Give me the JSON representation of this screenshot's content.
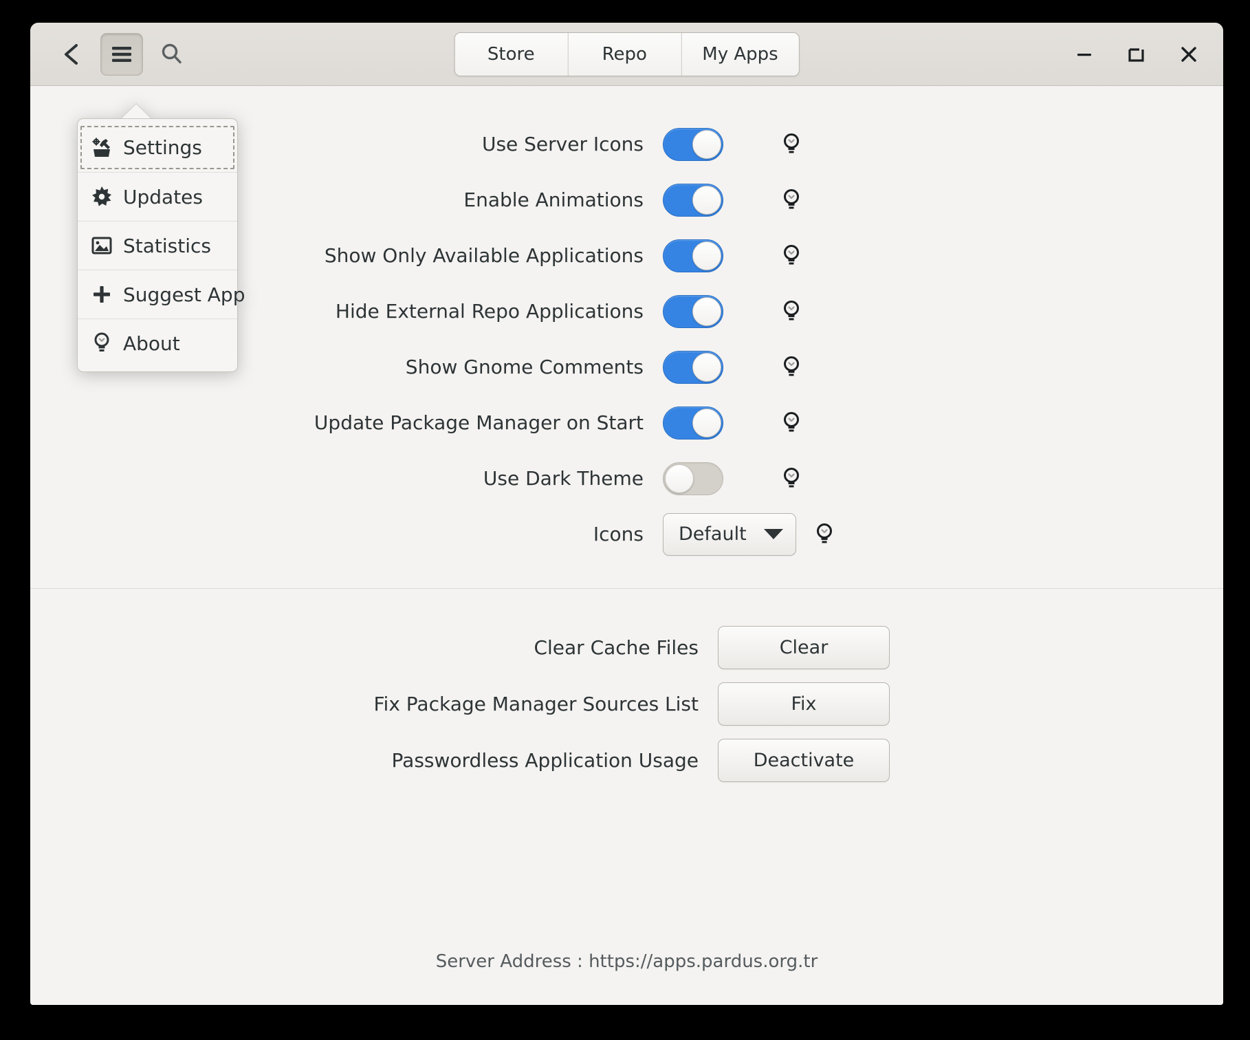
{
  "window": {
    "headerbar": {
      "back_icon": "back-arrow-icon",
      "menu_icon": "hamburger-menu-icon",
      "search_icon": "search-icon",
      "tabs": [
        {
          "label": "Store"
        },
        {
          "label": "Repo"
        },
        {
          "label": "My Apps"
        }
      ],
      "window_controls": {
        "minimize": "minimize-icon",
        "maximize": "maximize-restore-icon",
        "close": "close-icon"
      }
    },
    "menu": {
      "items": [
        {
          "label": "Settings",
          "icon": "toolbox-wrench-icon",
          "focused": true
        },
        {
          "label": "Updates",
          "icon": "gear-star-icon",
          "focused": false
        },
        {
          "label": "Statistics",
          "icon": "image-chart-icon",
          "focused": false
        },
        {
          "label": "Suggest App",
          "icon": "plus-icon",
          "focused": false
        },
        {
          "label": "About",
          "icon": "lightbulb-icon",
          "focused": false
        }
      ]
    },
    "settings": {
      "info_icon": "lightbulb-info-icon",
      "toggles": [
        {
          "label": "Use Server Icons",
          "on": true
        },
        {
          "label": "Enable Animations",
          "on": true
        },
        {
          "label": "Show Only Available Applications",
          "on": true
        },
        {
          "label": "Hide External Repo Applications",
          "on": true
        },
        {
          "label": "Show Gnome Comments",
          "on": true
        },
        {
          "label": "Update Package Manager on Start",
          "on": true
        },
        {
          "label": "Use Dark Theme",
          "on": false
        }
      ],
      "icons_row": {
        "label": "Icons",
        "value": "Default",
        "caret": "chevron-down-icon"
      }
    },
    "actions": [
      {
        "label": "Clear Cache Files",
        "button": "Clear"
      },
      {
        "label": "Fix Package Manager Sources List",
        "button": "Fix"
      },
      {
        "label": "Passwordless Application Usage",
        "button": "Deactivate"
      }
    ],
    "footer": {
      "text": "Server Address : https://apps.pardus.org.tr"
    },
    "colors": {
      "accent": "#3584e4",
      "toggle_off": "#d4d0ca",
      "header_bg": "#dedbd6",
      "content_bg": "#f4f3f1",
      "text": "#2e3436"
    }
  }
}
